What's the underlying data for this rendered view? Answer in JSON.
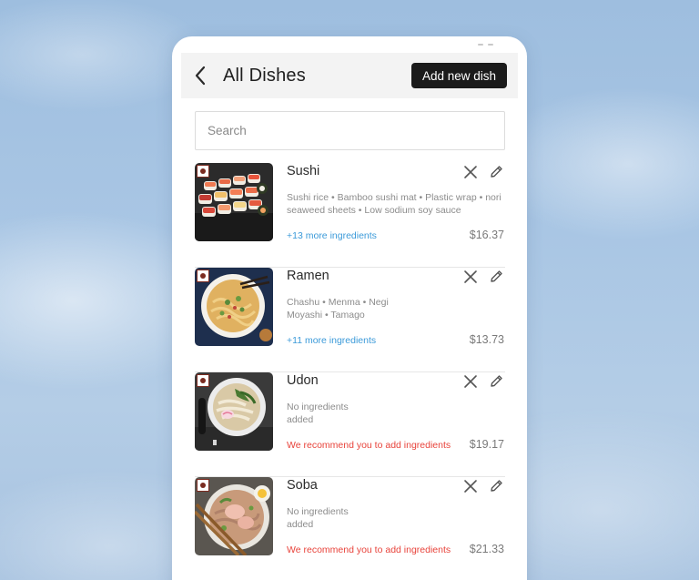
{
  "header": {
    "title": "All Dishes",
    "add_button": "Add new dish"
  },
  "search": {
    "placeholder": "Search"
  },
  "dishes": [
    {
      "name": "Sushi",
      "ingredients": "Sushi rice • Bamboo sushi mat • Plastic wrap • nori seaweed sheets • Low sodium soy sauce",
      "more": "+13 more ingredients",
      "warning": "",
      "price": "$16.37"
    },
    {
      "name": "Ramen",
      "ingredients": "Chashu • Menma • Negi\nMoyashi • Tamago",
      "more": "+11 more ingredients",
      "warning": "",
      "price": "$13.73"
    },
    {
      "name": "Udon",
      "ingredients": "No ingredients\nadded",
      "more": "",
      "warning": "We recommend you to add ingredients",
      "price": "$19.17"
    },
    {
      "name": "Soba",
      "ingredients": "No ingredients\nadded",
      "more": "",
      "warning": "We recommend you to add ingredients",
      "price": "$21.33"
    }
  ],
  "icons": {
    "back": "chevron-left-icon",
    "remove": "close-icon",
    "edit": "pencil-icon",
    "badge": "category-badge-icon"
  },
  "colors": {
    "button_bg": "#1b1b1b",
    "link": "#3b9ad9",
    "warning": "#e8433b",
    "badge": "#7a2a1f"
  }
}
